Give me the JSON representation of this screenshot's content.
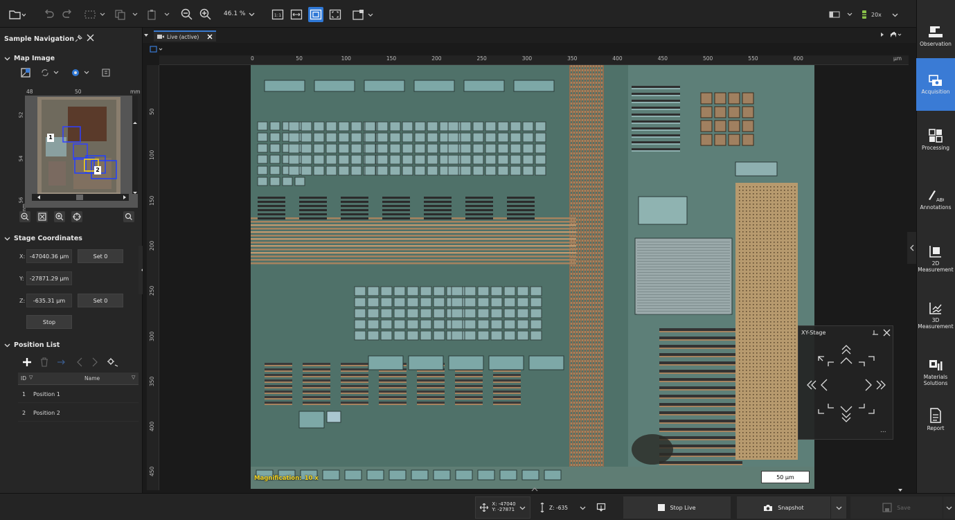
{
  "toolbar": {
    "zoom_level": "46.1 %",
    "objective": "20x"
  },
  "sample_navigation": {
    "title": "Sample Navigation",
    "map_image": {
      "label": "Map Image",
      "axis_top": [
        "48",
        "50",
        "mm"
      ],
      "axis_left": [
        "52",
        "54",
        "56",
        "mm"
      ],
      "marker_1": "1",
      "marker_2": "2"
    },
    "stage": {
      "label": "Stage Coordinates",
      "x_label": "X:",
      "x_value": "-47040.36 µm",
      "y_label": "Y:",
      "y_value": "-27871.29 µm",
      "z_label": "Z:",
      "z_value": "-635.31 µm",
      "set0_x": "Set 0",
      "set0_z": "Set 0",
      "stop": "Stop"
    },
    "position_list": {
      "label": "Position List",
      "col_id": "ID",
      "col_name": "Name",
      "rows": [
        {
          "id": "1",
          "name": "Position 1"
        },
        {
          "id": "2",
          "name": "Position 2"
        }
      ]
    }
  },
  "viewer": {
    "tab_label": "Live (active)",
    "ruler_x": [
      "0",
      "50",
      "100",
      "150",
      "200",
      "250",
      "300",
      "350",
      "400",
      "450",
      "500",
      "550",
      "600",
      "µm"
    ],
    "ruler_y": [
      "50",
      "100",
      "150",
      "200",
      "250",
      "300",
      "350",
      "400",
      "450"
    ],
    "magnification_label": "Magnification:",
    "magnification_value": "10 x",
    "scale_bar": "50 µm"
  },
  "xy_stage": {
    "title": "XY-Stage",
    "more": "..."
  },
  "bottom": {
    "coord_x": "X: -47040",
    "coord_y": "Y: -27871",
    "coord_z": "Z: -635",
    "stop_live": "Stop Live",
    "snapshot": "Snapshot",
    "save": "Save"
  },
  "rail": {
    "items": [
      {
        "label": "Observation"
      },
      {
        "label": "Acquisition"
      },
      {
        "label": "Processing"
      },
      {
        "label": "Annotations"
      },
      {
        "label": "2D Measurement"
      },
      {
        "label": "3D Measurement"
      },
      {
        "label": "Materials Solutions"
      },
      {
        "label": "Report"
      }
    ]
  },
  "colors": {
    "accent": "#3a7bd5",
    "highlight": "#2f78d6",
    "magnification_text": "#f0d020"
  }
}
